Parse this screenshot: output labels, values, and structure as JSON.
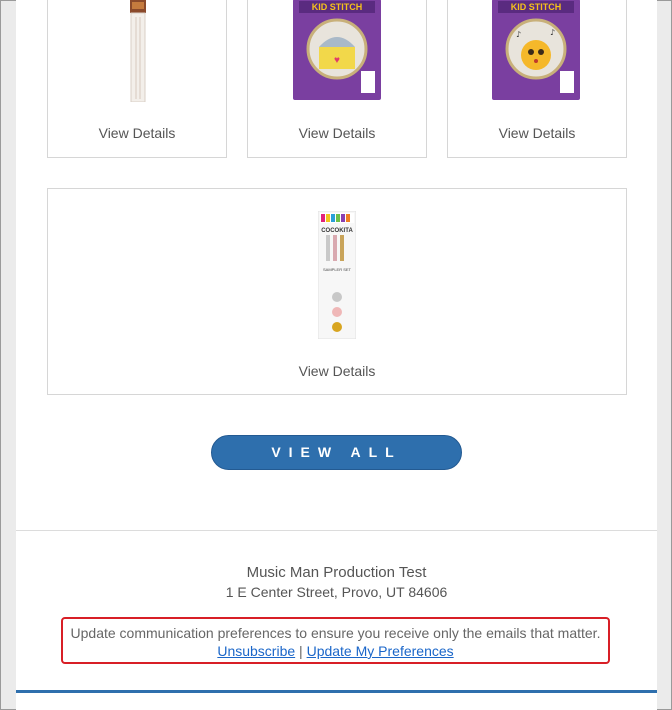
{
  "products": [
    {
      "link_label": "View Details",
      "thumb": "needle-packet-image"
    },
    {
      "link_label": "View Details",
      "thumb": "kid-stitch-cupcake-kit-image",
      "package_title": "KID STITCH"
    },
    {
      "link_label": "View Details",
      "thumb": "kid-stitch-emoji-kit-image",
      "package_title": "KID STITCH"
    },
    {
      "link_label": "View Details",
      "thumb": "cocokita-sampler-set-image",
      "package_title": "COCOKITA",
      "package_subtitle": "SAMPLER SET"
    }
  ],
  "view_all_label": "VIEW ALL",
  "footer": {
    "company_name": "Music Man Production Test",
    "address": "1 E Center Street, Provo, UT 84606",
    "preferences_message": "Update communication preferences to ensure you receive only the emails that matter.",
    "unsubscribe_label": "Unsubscribe",
    "separator": "|",
    "update_preferences_label": "Update My Preferences"
  },
  "colors": {
    "button": "#2e6fad",
    "highlight_border": "#d81f26",
    "link": "#1a66c9"
  }
}
